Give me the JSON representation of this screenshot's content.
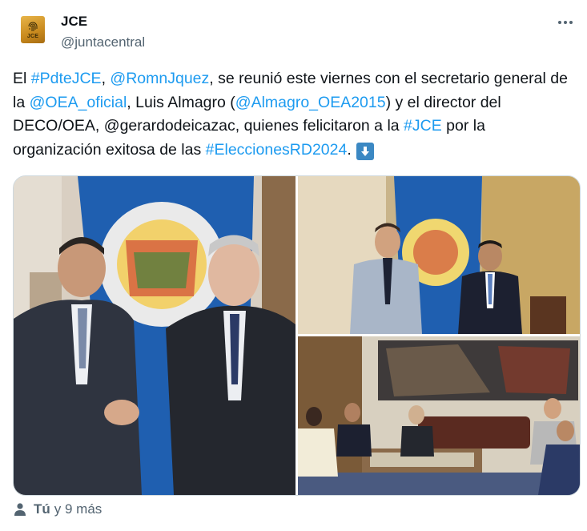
{
  "author": {
    "name": "JCE",
    "handle": "@juntacentral",
    "avatar_text": "JCE",
    "avatar_icon": "fingerprint-icon"
  },
  "menu_icon": "more-horizontal-icon",
  "tweet": {
    "segments": [
      {
        "text": "El ",
        "link": false
      },
      {
        "text": "#PdteJCE",
        "link": true
      },
      {
        "text": ", ",
        "link": false
      },
      {
        "text": "@RomnJquez",
        "link": true
      },
      {
        "text": ", se reunió este viernes con el secretario general de la ",
        "link": false
      },
      {
        "text": "@OEA_oficial",
        "link": true
      },
      {
        "text": ", Luis Almagro (",
        "link": false
      },
      {
        "text": "@Almagro_OEA2015",
        "link": true
      },
      {
        "text": ") y el director del DECO/OEA, @gerardodeicazac, quienes felicitaron a la ",
        "link": false
      },
      {
        "text": "#JCE",
        "link": true
      },
      {
        "text": " por la organización exitosa de las ",
        "link": false
      },
      {
        "text": "#EleccionesRD2024",
        "link": true
      },
      {
        "text": ".",
        "link": false
      }
    ],
    "emoji": "down-arrow-icon"
  },
  "media": {
    "photos": [
      {
        "name": "photo-handshake-flag",
        "icon": "photo"
      },
      {
        "name": "photo-standing-flag",
        "icon": "photo"
      },
      {
        "name": "photo-meeting-room",
        "icon": "photo"
      }
    ]
  },
  "footer": {
    "icon": "person-icon",
    "you_label": "Tú",
    "rest_label": "y 9 más"
  },
  "colors": {
    "link": "#1d9bf0",
    "text": "#0f1419",
    "secondary": "#536471",
    "border": "#cfd9de",
    "emoji_bg": "#3b88c3"
  }
}
